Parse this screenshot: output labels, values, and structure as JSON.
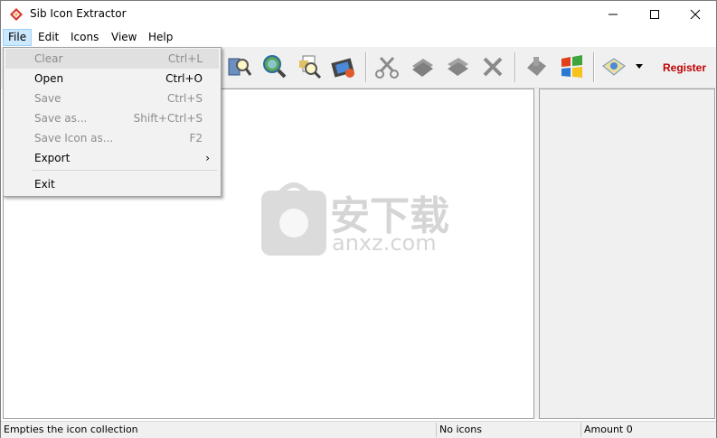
{
  "window": {
    "title": "Sib Icon Extractor"
  },
  "menubar": [
    {
      "label": "File",
      "active": true
    },
    {
      "label": "Edit"
    },
    {
      "label": "Icons"
    },
    {
      "label": "View"
    },
    {
      "label": "Help"
    }
  ],
  "toolbar": {
    "buttons": [
      "search-folder-icon",
      "search-globe-icon",
      "search-file-icon",
      "film-icon",
      "cut-icon",
      "copy-icon",
      "paste-icon",
      "delete-icon",
      "hand-icon",
      "windows-icon",
      "export-icon"
    ],
    "register_label": "Register"
  },
  "file_menu": {
    "items": [
      {
        "label": "Clear",
        "shortcut": "Ctrl+L",
        "disabled": true,
        "highlighted": true
      },
      {
        "label": "Open",
        "shortcut": "Ctrl+O",
        "disabled": false
      },
      {
        "label": "Save",
        "shortcut": "Ctrl+S",
        "disabled": true
      },
      {
        "label": "Save as...",
        "shortcut": "Shift+Ctrl+S",
        "disabled": true
      },
      {
        "label": "Save Icon as...",
        "shortcut": "F2",
        "disabled": true
      },
      {
        "label": "Export",
        "shortcut": "›",
        "disabled": false
      },
      {
        "label": "Exit",
        "shortcut": "",
        "disabled": false
      }
    ]
  },
  "statusbar": {
    "hint": "Empties the icon collection",
    "icons": "No icons",
    "amount": "Amount 0"
  },
  "watermark": {
    "text": "安下载",
    "subtext": "anxz.com"
  },
  "colors": {
    "register": "#c00000",
    "menu_active_bg": "#cce8ff"
  }
}
